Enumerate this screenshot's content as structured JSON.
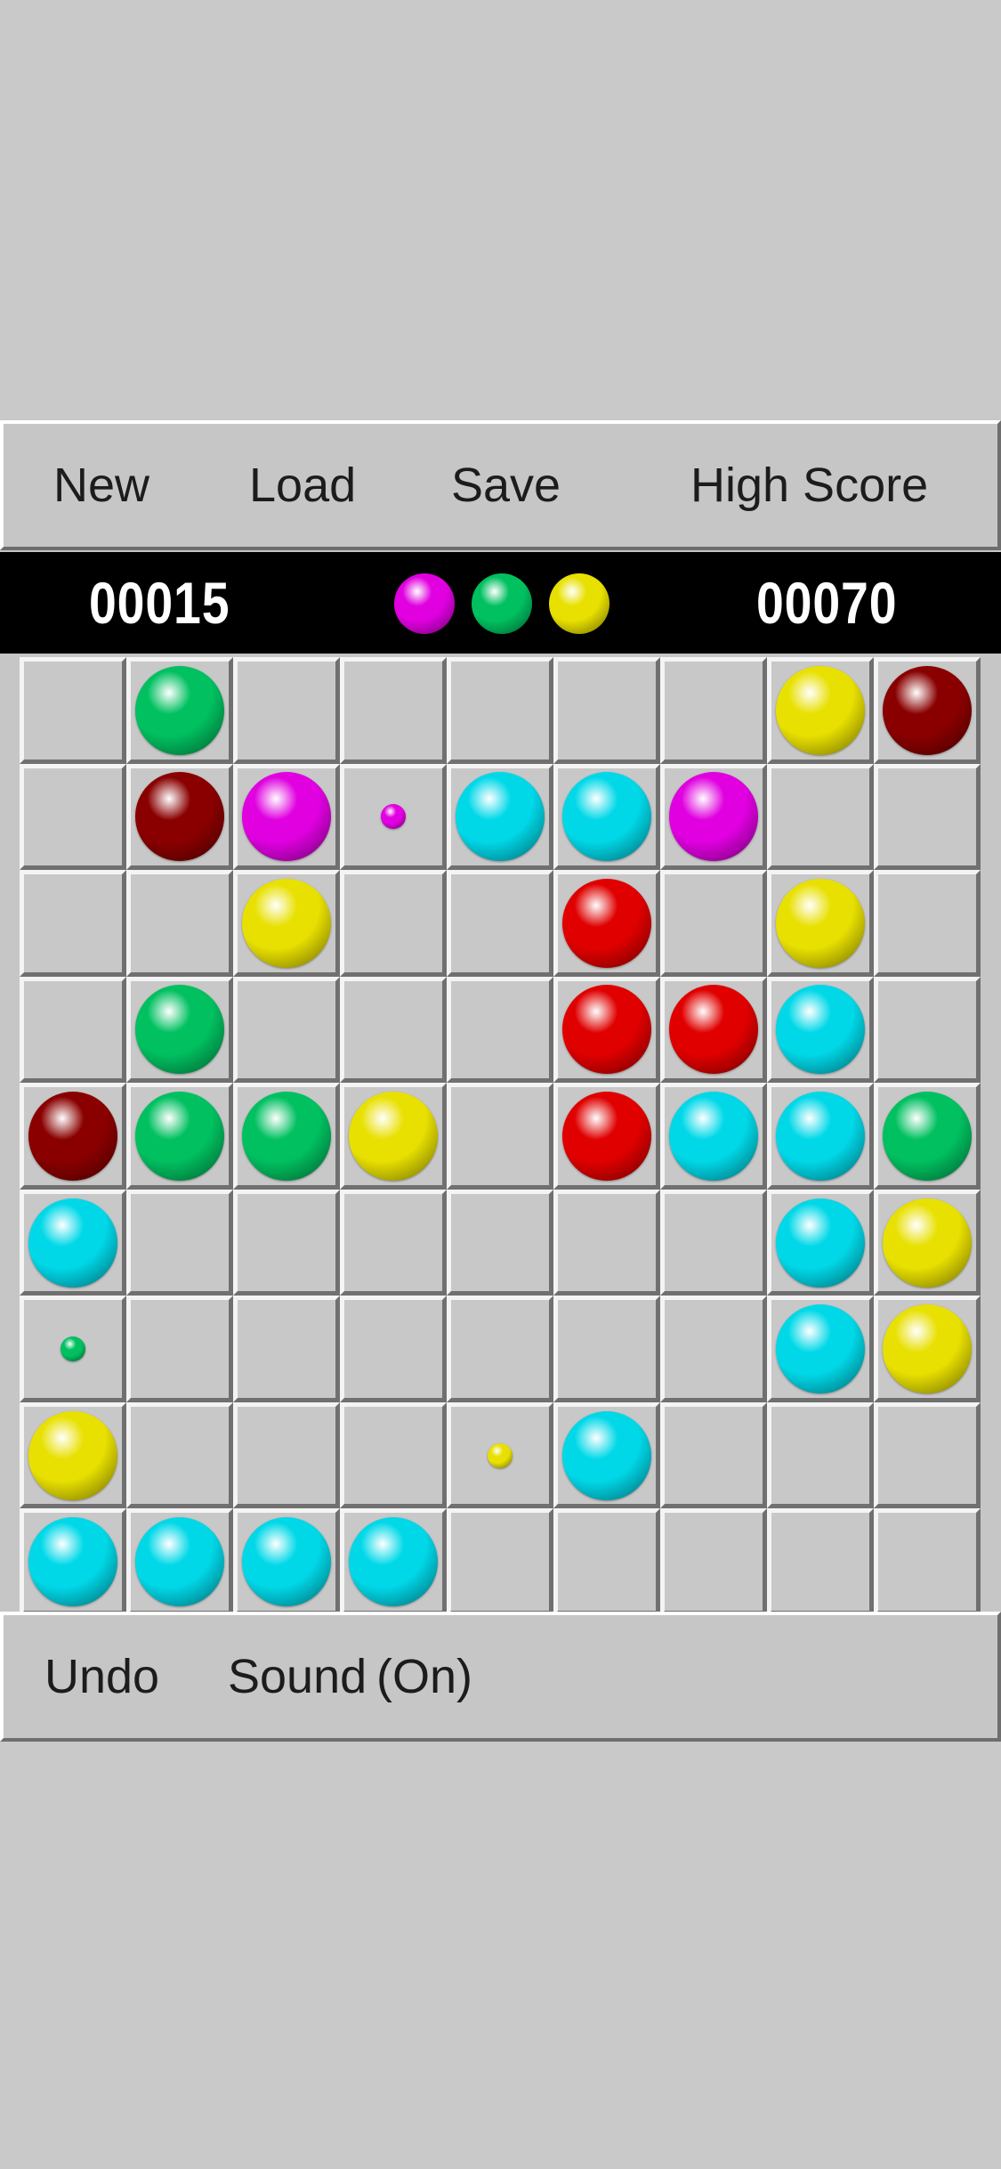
{
  "menu": {
    "new_label": "New",
    "load_label": "Load",
    "save_label": "Save",
    "high_score_label": "High Score"
  },
  "score": {
    "current": "00015",
    "high": "00070"
  },
  "next_balls": [
    "magenta",
    "green",
    "yellow"
  ],
  "colors": {
    "magenta": "#e000e0",
    "green": "#00c060",
    "yellow": "#e8e000",
    "cyan": "#00d8e8",
    "red": "#e00000",
    "darkred": "#8a0000",
    "board_bg": "#c6c6c6",
    "score_bar_bg": "#000000"
  },
  "board": {
    "rows": 9,
    "cols": 9,
    "grid": [
      [
        "",
        "green",
        "",
        "",
        "",
        "",
        "",
        "yellow",
        "darkred"
      ],
      [
        "",
        "darkred",
        "magenta",
        "magenta-small",
        "cyan",
        "cyan",
        "magenta",
        "",
        ""
      ],
      [
        "",
        "",
        "yellow",
        "",
        "",
        "red",
        "",
        "yellow",
        ""
      ],
      [
        "",
        "green",
        "",
        "",
        "",
        "red",
        "red",
        "cyan",
        ""
      ],
      [
        "darkred",
        "green",
        "green",
        "yellow",
        "",
        "red",
        "cyan",
        "cyan",
        "green"
      ],
      [
        "cyan",
        "",
        "",
        "",
        "",
        "",
        "",
        "cyan",
        "yellow"
      ],
      [
        "green-small",
        "",
        "",
        "",
        "",
        "",
        "",
        "cyan",
        "yellow"
      ],
      [
        "yellow",
        "",
        "",
        "",
        "yellow-small",
        "cyan",
        "",
        "",
        ""
      ],
      [
        "cyan",
        "cyan",
        "cyan",
        "cyan",
        "",
        "",
        "",
        "",
        ""
      ]
    ]
  },
  "bottom": {
    "undo_label": "Undo",
    "sound_label": "Sound",
    "sound_state": "(On)"
  }
}
